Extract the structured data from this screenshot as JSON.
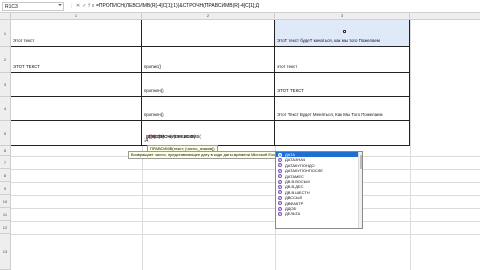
{
  "formula_bar": {
    "name_box": "R1C3",
    "formula": "=ПРОПИСН(ЛЕВСИМВ(R[-4]C[1];1))&СТРОЧН(ПРАВСИМВ(R[-4]C[1];Д"
  },
  "columns": [
    "1",
    "2",
    "3"
  ],
  "rows": [
    "1",
    "2",
    "3",
    "4",
    "5",
    "6",
    "7",
    "8",
    "9",
    "10",
    "11",
    "12",
    "13"
  ],
  "cells": {
    "r1c1": "Этот текст",
    "r1c3": "ЭтоТ текст будеТ кинаться, как мы того Пожелаем",
    "r2c1": "ЭТОТ ТЕКСТ",
    "r2c2": "пропис()",
    "r2c3": "этот текст",
    "r3c2": "пропнач()",
    "r3c3": "ЭТОТ ТЕКСТ",
    "r4c2": "пропнач()",
    "r4c3": "Этот Текст Будет Меняться, Как Мы Того Пожелаем",
    "r5c2_pre": "=ПРОПИСН(ЛЕВСИМВ(",
    "r5c2_ref1": "R[-4]C[1]",
    "r5c2_mid": ";1))&СТРОЧН(ПРАВСИМВ(",
    "r5c2_ref2": "R[-4]C[1]",
    "r5c2_post": ";Д"
  },
  "tooltips": {
    "signature": "ПРАВСИМВ(текст; [число_знаков])",
    "description": "Возвращает число, представляющее дату в коде даты-времени Microsoft Excel"
  },
  "autocomplete": {
    "items": [
      "ДАТА",
      "ДАТАЗНАЧ",
      "ДАТАКУПОНДО",
      "ДАТАКУПОНПОСЛЕ",
      "ДАТАМЕС",
      "ДВ.В.ВОСЬМ",
      "ДВ.В.ДЕС",
      "ДВ.В.ШЕСТН",
      "ДВССЫЛ",
      "ДВФАКТР",
      "ДДОБ",
      "ДЕЛЬТА"
    ],
    "active_index": 0
  }
}
